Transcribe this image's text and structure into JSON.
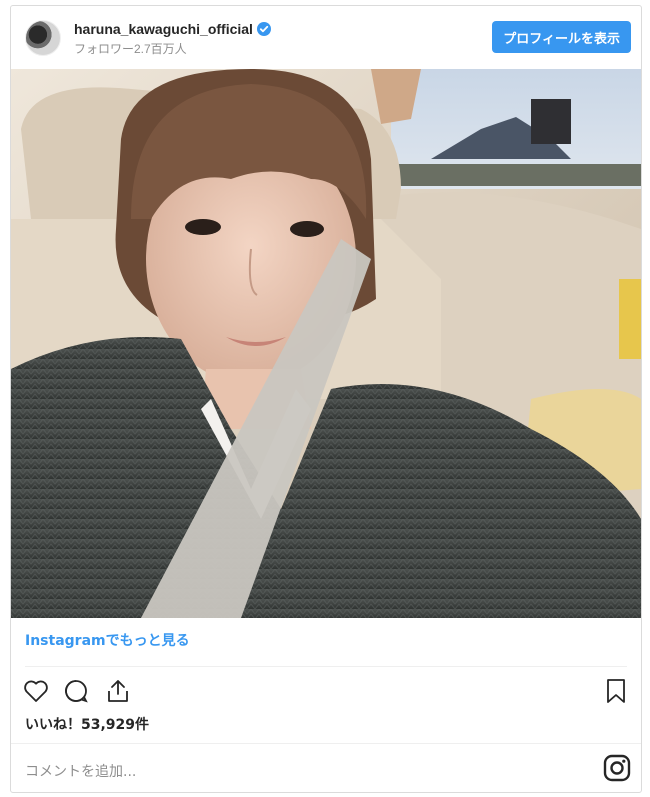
{
  "header": {
    "username": "haruna_kawaguchi_official",
    "followers": "フォロワー2.7百万人",
    "profile_button": "プロフィールを表示",
    "verified_color": "#3897f0"
  },
  "post": {
    "image_icon": "photo",
    "more_link": "Instagramでもっと見る",
    "likes_text": "いいね！53,929件",
    "comment_placeholder": "コメントを追加...",
    "icons": [
      "heart-icon",
      "comment-icon",
      "share-icon",
      "bookmark-icon",
      "instagram-icon"
    ]
  },
  "colors": {
    "accent": "#3897f0",
    "text": "#262626",
    "muted": "#8e8e8e",
    "border": "#dbdbdb"
  }
}
